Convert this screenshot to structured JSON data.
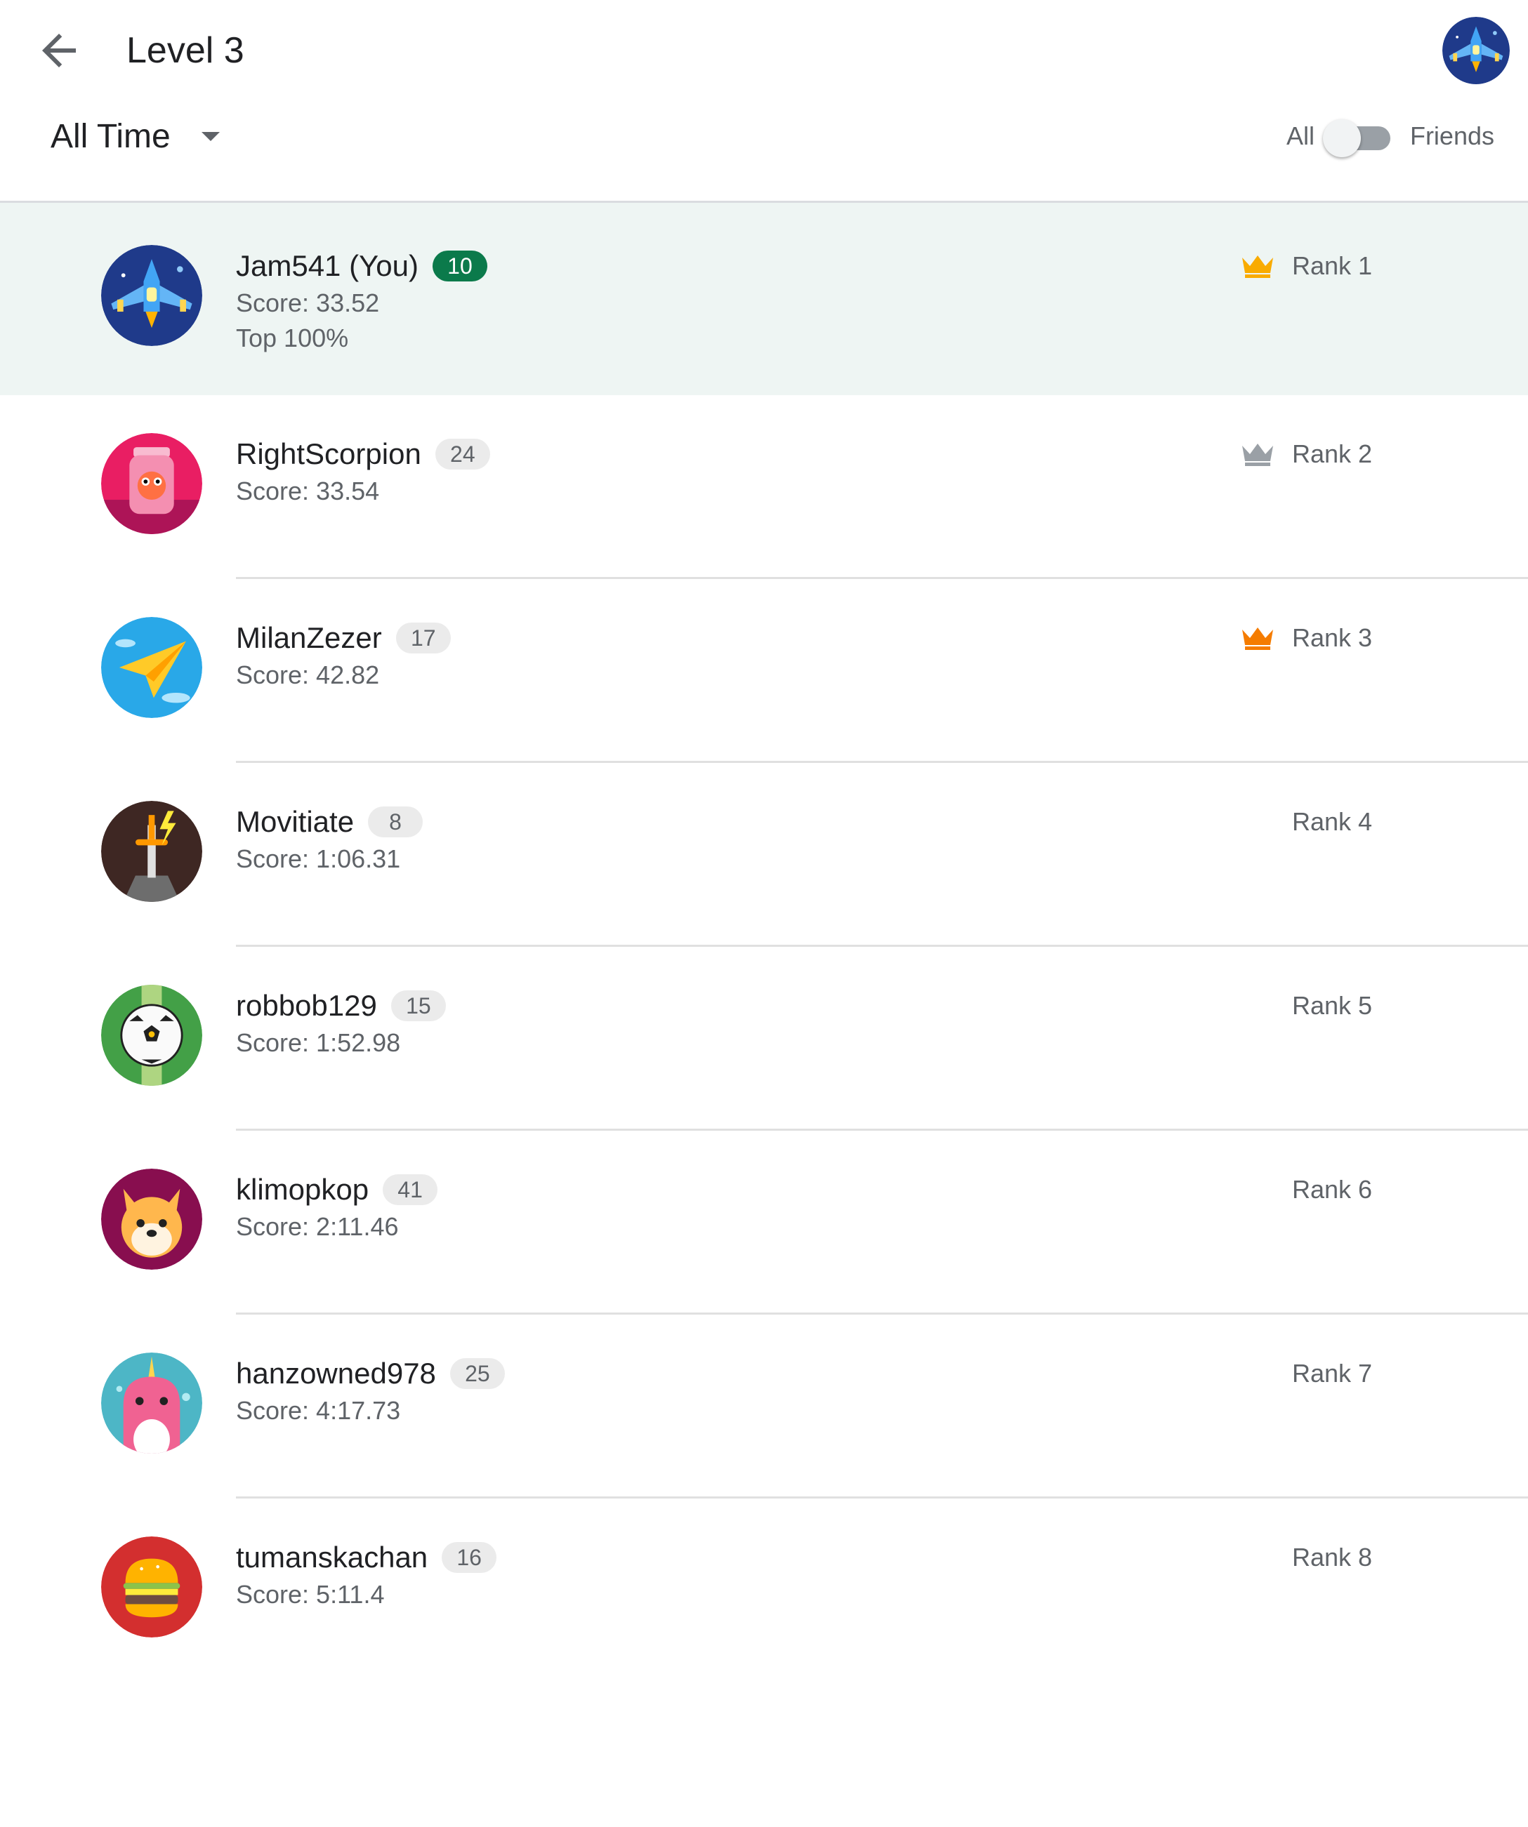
{
  "header": {
    "title": "Level 3"
  },
  "filters": {
    "time_range": "All Time",
    "toggle_left": "All",
    "toggle_right": "Friends"
  },
  "colors": {
    "you_highlight": "#eef5f3",
    "you_badge": "#0b7a4b",
    "crown_gold": "#f9ab00",
    "crown_silver": "#9aa0a6",
    "crown_bronze": "#f57c00"
  },
  "players": [
    {
      "name": "Jam541 (You)",
      "level": "10",
      "score": "Score: 33.52",
      "top": "Top 100%",
      "rank": "Rank 1",
      "crown": "crown-gold-icon",
      "avatar": "spaceship-avatar-icon",
      "is_you": true
    },
    {
      "name": "RightScorpion",
      "level": "24",
      "score": "Score: 33.54",
      "rank": "Rank 2",
      "crown": "crown-silver-icon",
      "avatar": "monster-jar-avatar-icon"
    },
    {
      "name": "MilanZezer",
      "level": "17",
      "score": "Score: 42.82",
      "rank": "Rank 3",
      "crown": "crown-bronze-icon",
      "avatar": "paper-plane-avatar-icon"
    },
    {
      "name": "Movitiate",
      "level": "8",
      "score": "Score: 1:06.31",
      "rank": "Rank 4",
      "avatar": "sword-avatar-icon"
    },
    {
      "name": "robbob129",
      "level": "15",
      "score": "Score: 1:52.98",
      "rank": "Rank 5",
      "avatar": "soccer-ball-avatar-icon"
    },
    {
      "name": "klimopkop",
      "level": "41",
      "score": "Score: 2:11.46",
      "rank": "Rank 6",
      "avatar": "shiba-dog-avatar-icon"
    },
    {
      "name": "hanzowned978",
      "level": "25",
      "score": "Score: 4:17.73",
      "rank": "Rank 7",
      "avatar": "narwhal-avatar-icon"
    },
    {
      "name": "tumanskachan",
      "level": "16",
      "score": "Score: 5:11.4",
      "rank": "Rank 8",
      "avatar": "burger-avatar-icon"
    }
  ]
}
